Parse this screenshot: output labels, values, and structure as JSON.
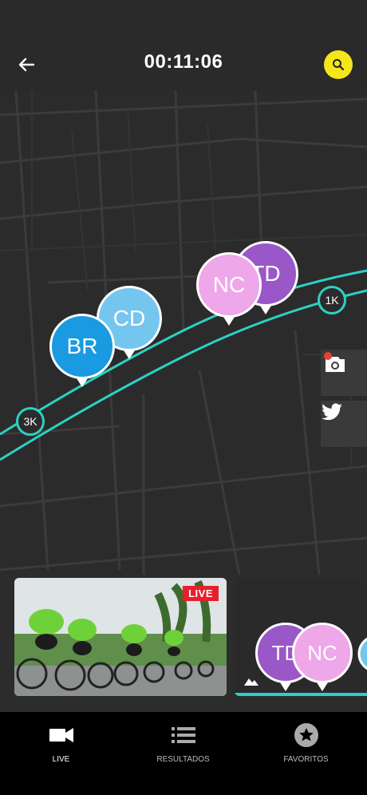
{
  "header": {
    "title": "00:11:06",
    "back_icon": "arrow-left-icon",
    "search_icon": "search-icon"
  },
  "map": {
    "runners": [
      {
        "initials": "BR",
        "color": "#1a9ae0"
      },
      {
        "initials": "CD",
        "color": "#75c6ee"
      },
      {
        "initials": "TD",
        "color": "#9a57c7"
      },
      {
        "initials": "NC",
        "color": "#eea7e8"
      }
    ],
    "markers": [
      {
        "label": "3K"
      },
      {
        "label": "1K"
      }
    ],
    "route_color": "#2bd1c3"
  },
  "side_actions": [
    {
      "icon": "camera-icon"
    },
    {
      "icon": "twitter-icon"
    }
  ],
  "strip": {
    "live_label": "LIVE",
    "mini_runners": [
      {
        "initials": "TD",
        "color": "#9a57c7"
      },
      {
        "initials": "NC",
        "color": "#eea7e8"
      }
    ]
  },
  "nav": {
    "items": [
      {
        "label": "LIVE",
        "icon": "video-camera-icon"
      },
      {
        "label": "RESULTADOS",
        "icon": "list-icon"
      },
      {
        "label": "FAVORITOS",
        "icon": "star-icon"
      }
    ]
  }
}
